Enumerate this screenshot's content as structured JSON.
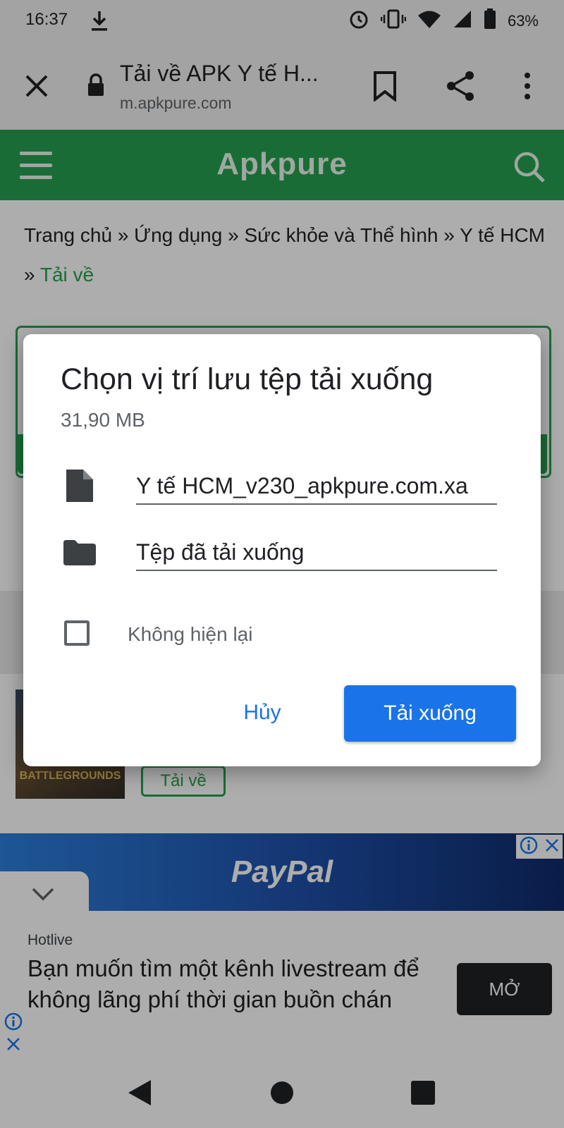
{
  "status_bar": {
    "time": "16:37",
    "battery_percent": "63%",
    "icons": [
      "download-icon",
      "alarm-icon",
      "vibrate-icon",
      "wifi-icon",
      "signal-icon",
      "battery-icon"
    ]
  },
  "browser": {
    "page_title": "Tải về APK Y tế H...",
    "url": "m.apkpure.com",
    "icons": [
      "close-icon",
      "lock-icon",
      "bookmark-icon",
      "share-icon",
      "more-vert-icon"
    ]
  },
  "site_header": {
    "logo": "Apkpure",
    "icons": [
      "menu-icon",
      "search-icon"
    ],
    "color": "#25a04e"
  },
  "breadcrumb": {
    "items": [
      "Trang chủ",
      "Ứng dụng",
      "Sức khỏe và Thể hình",
      "Y tế HCM"
    ],
    "separator": "»",
    "current": "Tải về"
  },
  "background": {
    "game_thumb_text": "BATTLEGROUNDS",
    "download_label": "Tải về",
    "ad_brand": "PayPal",
    "native_ad": {
      "sponsor": "Hotlive",
      "headline": "Bạn muốn tìm một kênh livestream để không lãng phí thời gian buồn chán",
      "open_button": "MỞ"
    }
  },
  "dialog": {
    "title": "Chọn vị trí lưu tệp tải xuống",
    "file_size": "31,90 MB",
    "file_name": "Y tế HCM_v230_apkpure.com.xa",
    "folder": "Tệp đã tải xuống",
    "checkbox_label": "Không hiện lại",
    "checkbox_checked": false,
    "cancel_label": "Hủy",
    "download_label": "Tải xuống",
    "accent_color": "#1a73e8"
  }
}
